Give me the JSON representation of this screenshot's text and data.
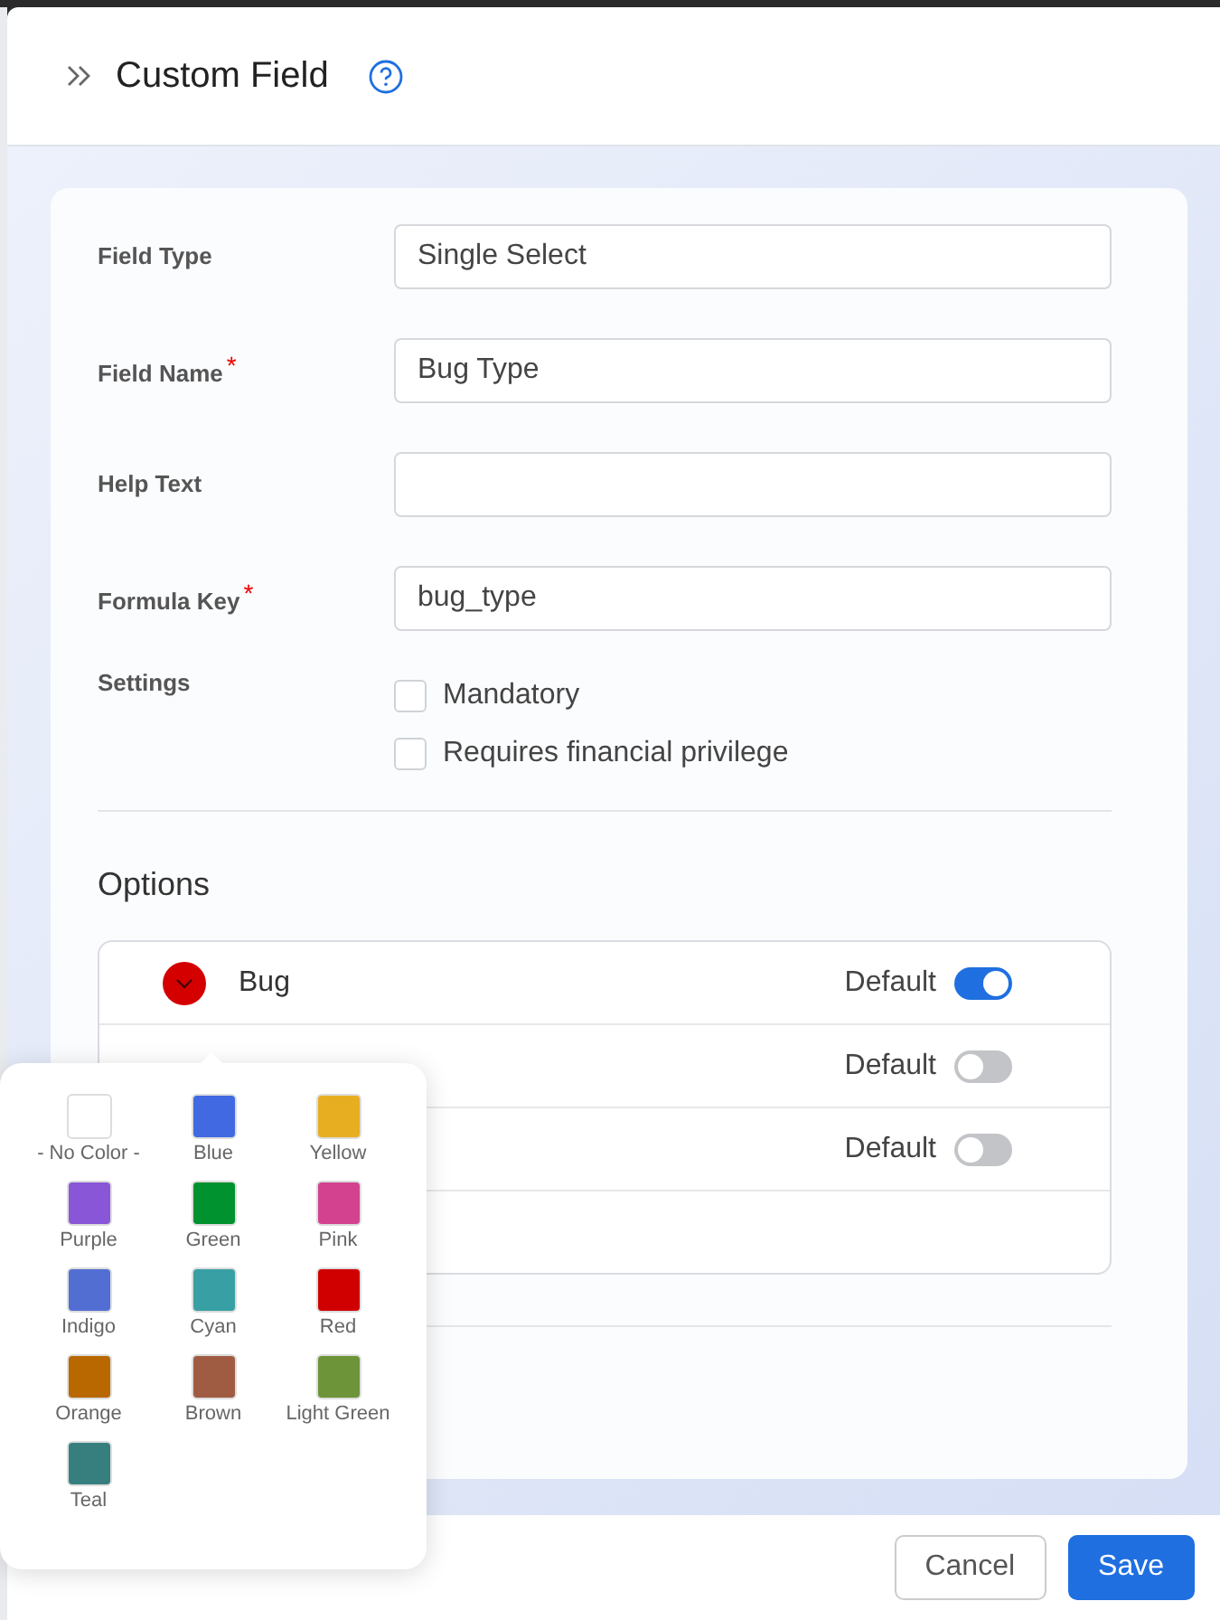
{
  "header": {
    "title": "Custom Field"
  },
  "fields": [
    {
      "label": "Field Type",
      "value": "Single Select"
    },
    {
      "label": "Field Name",
      "required_mark": "*",
      "value": "Bug Type"
    },
    {
      "label": "Help Text"
    },
    {
      "label": "Formula Key",
      "required_mark": "*",
      "value": "bug_type"
    }
  ],
  "settings": {
    "label": "Settings",
    "options": [
      {
        "label": "Mandatory",
        "checked": false
      },
      {
        "label": "Requires financial privilege",
        "checked": false
      }
    ]
  },
  "options": {
    "title": "Options",
    "rows": [
      {
        "label": "Bug",
        "color": "#d40000",
        "default_label": "Default",
        "default": true
      },
      {
        "default_label": "Default",
        "default": false
      },
      {
        "default_label": "Default",
        "default": false
      }
    ]
  },
  "color_picker": {
    "swatches": [
      {
        "name": "- No Color -",
        "color": "#ffffff"
      },
      {
        "name": "Blue",
        "color": "#4169e1"
      },
      {
        "name": "Yellow",
        "color": "#e8ae22"
      },
      {
        "name": "Purple",
        "color": "#8a56d8"
      },
      {
        "name": "Green",
        "color": "#00922e"
      },
      {
        "name": "Pink",
        "color": "#d2428e"
      },
      {
        "name": "Indigo",
        "color": "#536ed3"
      },
      {
        "name": "Cyan",
        "color": "#38a0a4"
      },
      {
        "name": "Red",
        "color": "#d10000"
      },
      {
        "name": "Orange",
        "color": "#b96800"
      },
      {
        "name": "Brown",
        "color": "#a05c42"
      },
      {
        "name": "Light Green",
        "color": "#6d9438"
      },
      {
        "name": "Teal",
        "color": "#377f7f"
      }
    ]
  },
  "footer": {
    "buttons": [
      {
        "label": "Cancel",
        "kind": "secondary"
      },
      {
        "label": "Save",
        "kind": "primary"
      }
    ]
  }
}
